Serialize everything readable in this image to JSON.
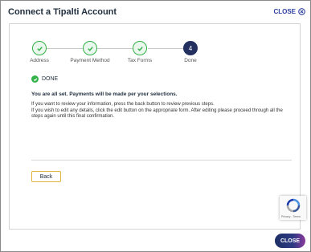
{
  "dialog": {
    "title": "Connect a Tipalti Account",
    "close_link_label": "CLOSE"
  },
  "stepper": {
    "steps": [
      {
        "label": "Address",
        "state": "done"
      },
      {
        "label": "Payment Method",
        "state": "done"
      },
      {
        "label": "Tax Forms",
        "state": "done"
      },
      {
        "label": "Done",
        "state": "current",
        "number": "4"
      }
    ]
  },
  "status": {
    "label": "DONE"
  },
  "message": {
    "headline": "You are all set. Payments will be made per your selections.",
    "line1": "If you want to review your information, press the back button to review previous steps.",
    "line2": "If you wish to edit any details, click the edit button on the appropriate form. After editing please proceed through all the steps again until this final confirmation."
  },
  "buttons": {
    "back_label": "Back",
    "close_label": "CLOSE"
  },
  "recaptcha": {
    "links": "Privacy - Terms"
  },
  "colors": {
    "accent_navy": "#23305f",
    "success_green": "#33b249",
    "back_border": "#e3b340"
  }
}
